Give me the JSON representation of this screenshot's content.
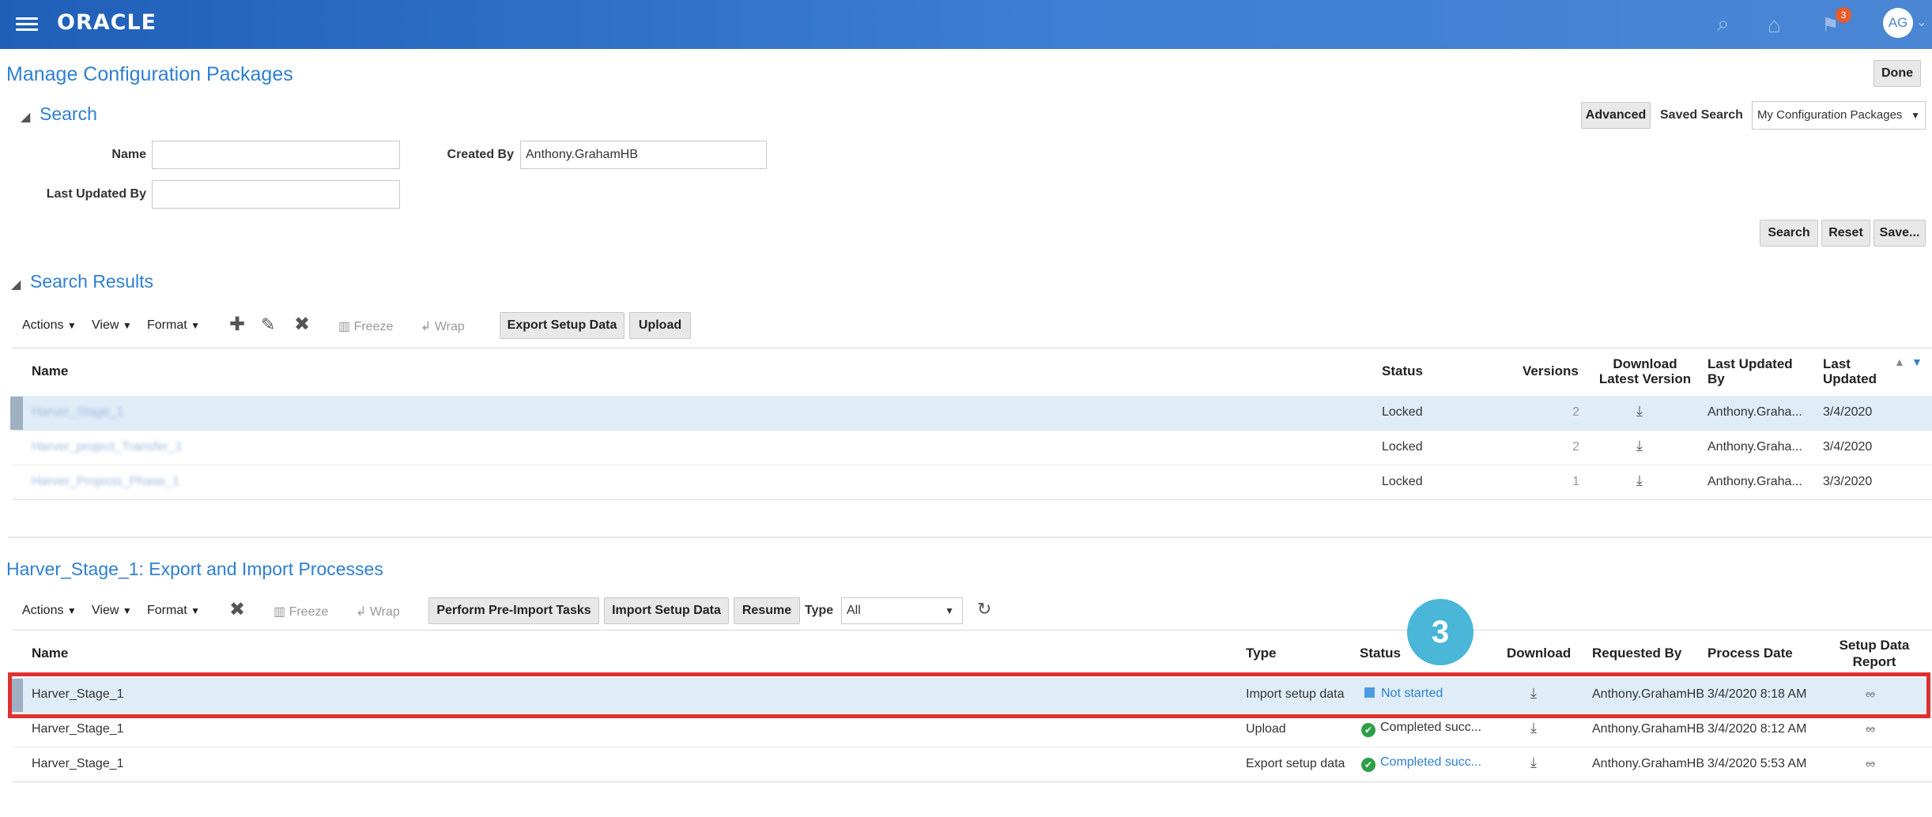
{
  "header": {
    "logo": "ORACLE",
    "notification_count": "3",
    "avatar_initials": "AG"
  },
  "page": {
    "title": "Manage Configuration Packages",
    "done_label": "Done"
  },
  "search": {
    "title": "Search",
    "advanced_label": "Advanced",
    "saved_search_label": "Saved Search",
    "saved_search_value": "My Configuration Packages",
    "fields": {
      "name_label": "Name",
      "name_value": "",
      "created_by_label": "Created By",
      "created_by_value": "Anthony.GrahamHB",
      "last_updated_by_label": "Last Updated By",
      "last_updated_by_value": ""
    },
    "buttons": {
      "search": "Search",
      "reset": "Reset",
      "save": "Save..."
    }
  },
  "results": {
    "title": "Search Results",
    "toolbar": {
      "actions": "Actions",
      "view": "View",
      "format": "Format",
      "freeze": "Freeze",
      "wrap": "Wrap",
      "export": "Export Setup Data",
      "upload": "Upload"
    },
    "columns": {
      "name": "Name",
      "status": "Status",
      "versions": "Versions",
      "download_1": "Download",
      "download_2": "Latest Version",
      "last_updated_by_1": "Last Updated",
      "last_updated_by_2": "By",
      "last_updated_1": "Last",
      "last_updated_2": "Updated"
    },
    "rows": [
      {
        "name": "Harver_Stage_1",
        "status": "Locked",
        "versions": "2",
        "updated_by": "Anthony.Graha...",
        "updated": "3/4/2020"
      },
      {
        "name": "Harver_project_Transfer_1",
        "status": "Locked",
        "versions": "2",
        "updated_by": "Anthony.Graha...",
        "updated": "3/4/2020"
      },
      {
        "name": "Harver_Projects_Phase_1",
        "status": "Locked",
        "versions": "1",
        "updated_by": "Anthony.Graha...",
        "updated": "3/3/2020"
      }
    ]
  },
  "processes": {
    "title": "Harver_Stage_1: Export and Import Processes",
    "toolbar": {
      "actions": "Actions",
      "view": "View",
      "format": "Format",
      "freeze": "Freeze",
      "wrap": "Wrap",
      "pre_import": "Perform Pre-Import Tasks",
      "import": "Import Setup Data",
      "resume": "Resume",
      "type_label": "Type",
      "type_value": "All"
    },
    "callout": "3",
    "columns": {
      "name": "Name",
      "type": "Type",
      "status": "Status",
      "download": "Download",
      "requested_by": "Requested By",
      "process_date": "Process Date",
      "report_1": "Setup Data",
      "report_2": "Report"
    },
    "rows": [
      {
        "name": "Harver_Stage_1",
        "type": "Import setup data",
        "status": "Not started",
        "requested_by": "Anthony.GrahamHB",
        "date": "3/4/2020 8:18 AM"
      },
      {
        "name": "Harver_Stage_1",
        "type": "Upload",
        "status": "Completed succ...",
        "requested_by": "Anthony.GrahamHB",
        "date": "3/4/2020 8:12 AM"
      },
      {
        "name": "Harver_Stage_1",
        "type": "Export setup data",
        "status": "Completed succ...",
        "requested_by": "Anthony.GrahamHB",
        "date": "3/4/2020 5:53 AM"
      }
    ]
  },
  "colors": {
    "header_blue": "#3d7fd4",
    "title_blue": "#2f7fd0",
    "selected_row": "#dfedf8",
    "highlight_red": "#e03030",
    "callout_teal": "#4ab6d8",
    "success_green": "#2e9f48"
  }
}
